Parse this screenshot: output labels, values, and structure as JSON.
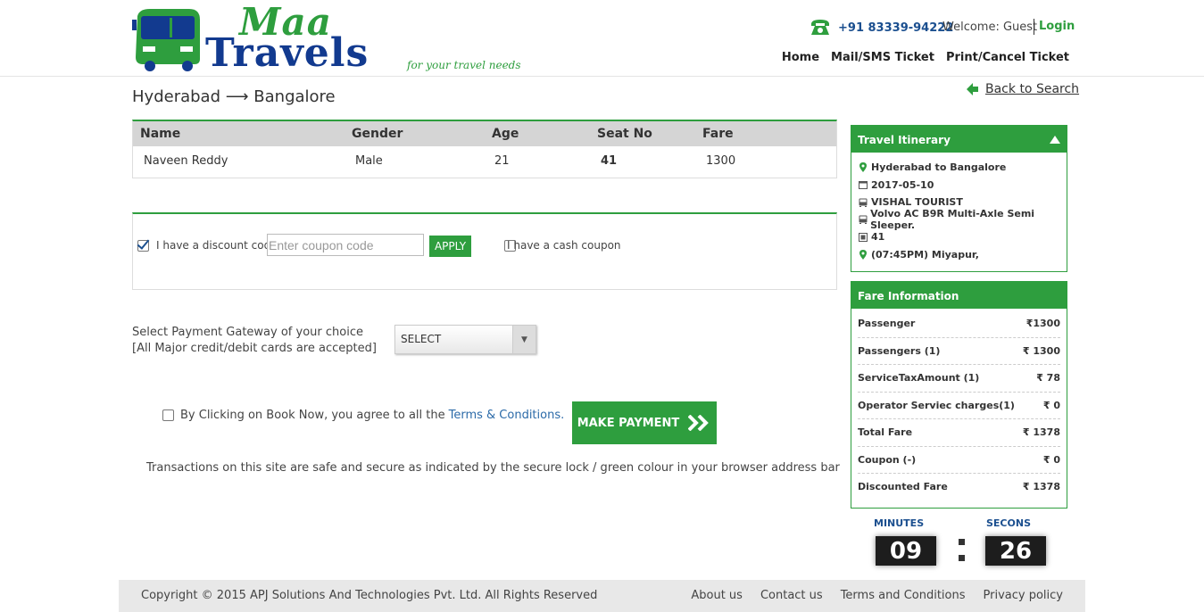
{
  "logo": {
    "line1": "Maa",
    "line2": "Travels",
    "tagline": "for your travel needs"
  },
  "header": {
    "phone": "+91 83339-94222",
    "welcome": "Welcome: Guest",
    "login": "Login",
    "nav": [
      "Home",
      "Mail/SMS Ticket",
      "Print/Cancel Ticket"
    ]
  },
  "route": {
    "from": "Hyderabad",
    "arrow": "⟶",
    "to": "Bangalore"
  },
  "back_to_search": "Back to Search",
  "passenger_table": {
    "headers": [
      "Name",
      "Gender",
      "Age",
      "Seat No",
      "Fare"
    ],
    "rows": [
      [
        "Naveen Reddy",
        "Male",
        "21",
        "41",
        "1300"
      ]
    ]
  },
  "coupon": {
    "discount_label": "I have a discount code",
    "discount_checked": true,
    "input_placeholder": "Enter coupon code",
    "apply_label": "APPLY",
    "cash_label": "I have a cash coupon",
    "cash_checked": false
  },
  "payment_gateway": {
    "label_line1": "Select Payment Gateway of your choice",
    "label_line2": "[All Major credit/debit cards are accepted]",
    "selected": "SELECT"
  },
  "terms": {
    "text": "By Clicking on Book Now, you agree to all the",
    "link": "Terms & Conditions.",
    "checked": false
  },
  "make_payment_label": "MAKE PAYMENT",
  "secure_note": "Transactions on this site are safe and secure as indicated by the secure lock / green colour in your browser address bar",
  "itinerary": {
    "title": "Travel Itinerary",
    "route": "Hyderabad to Bangalore",
    "date": "2017-05-10",
    "operator": "VISHAL TOURIST",
    "bus_type": "Volvo AC B9R Multi-Axle Semi Sleeper.",
    "seat": "41",
    "boarding": "(07:45PM) Miyapur,"
  },
  "fare_info": {
    "title": "Fare Information",
    "rows": [
      {
        "label": "Passenger",
        "value": "₹1300"
      },
      {
        "label": "Passengers (1)",
        "value": "₹ 1300"
      },
      {
        "label": "ServiceTaxAmount (1)",
        "value": "₹ 78"
      },
      {
        "label": "Operator Serviec charges(1)",
        "value": "₹ 0"
      },
      {
        "label": "Total Fare",
        "value": "₹ 1378"
      },
      {
        "label": "Coupon (-)",
        "value": "₹ 0"
      },
      {
        "label": "Discounted Fare",
        "value": "₹ 1378"
      }
    ]
  },
  "timer": {
    "minutes_label": "MINUTES",
    "seconds_label": "SECONS",
    "minutes": "09",
    "seconds": "26"
  },
  "footer": {
    "copyright": "Copyright © 2015 APJ Solutions And Technologies Pvt. Ltd. All Rights Reserved",
    "links": [
      "About us",
      "Contact us",
      "Terms and Conditions",
      "Privacy policy"
    ]
  },
  "colors": {
    "brand_green": "#2e9e3e",
    "brand_blue": "#123a8f",
    "link_blue": "#2b6aa8"
  }
}
